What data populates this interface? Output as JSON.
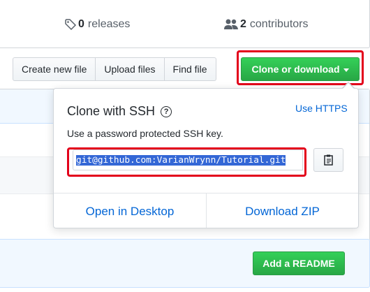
{
  "summary": {
    "releases_count": "0",
    "releases_label": "releases",
    "contributors_count": "2",
    "contributors_label": "contributors"
  },
  "toolbar": {
    "create_new_file": "Create new file",
    "upload_files": "Upload files",
    "find_file": "Find file",
    "clone_or_download": "Clone or download"
  },
  "clone_panel": {
    "title": "Clone with SSH",
    "help_glyph": "?",
    "use_https": "Use HTTPS",
    "description": "Use a password protected SSH key.",
    "url": "git@github.com:VarianWrynn/Tutorial.git",
    "open_in_desktop": "Open in Desktop",
    "download_zip": "Download ZIP"
  },
  "readme": {
    "add_readme": "Add a README"
  },
  "colors": {
    "accent_blue": "#0366d6",
    "primary_green": "#28a745",
    "highlight_red": "#e3001b"
  }
}
